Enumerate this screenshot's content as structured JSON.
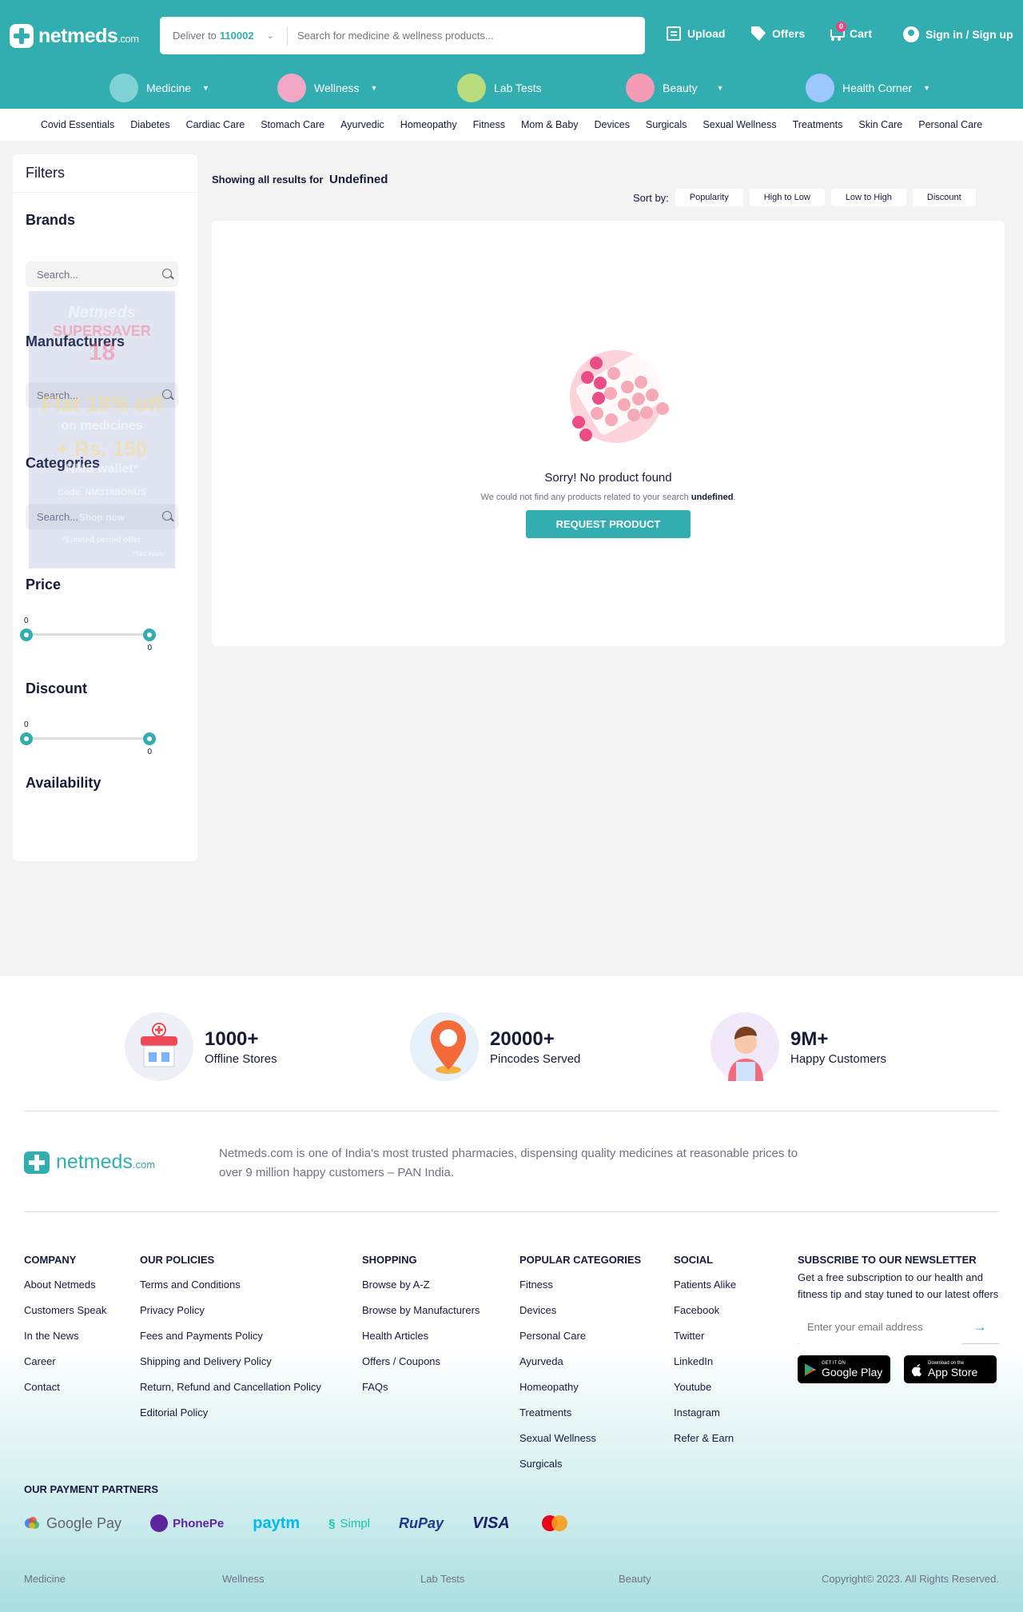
{
  "header": {
    "logo": "netmeds",
    "logo_suffix": ".com",
    "deliver_label": "Deliver to",
    "pincode": "110002",
    "search_placeholder": "Search for medicine & wellness products...",
    "upload": "Upload",
    "offers": "Offers",
    "cart": "Cart",
    "cart_count": "0",
    "signin": "Sign in / Sign up",
    "brand_color": "#32aeb1"
  },
  "categories": [
    {
      "label": "Medicine",
      "icon": "medicine-bottle-icon",
      "color": "#7fd3d4",
      "dropdown": true
    },
    {
      "label": "Wellness",
      "icon": "wellness-icon",
      "color": "#f2a8c4",
      "dropdown": true
    },
    {
      "label": "Lab Tests",
      "icon": "lab-tests-icon",
      "color": "#b9dd7d",
      "dropdown": false
    },
    {
      "label": "Beauty",
      "icon": "beauty-icon",
      "color": "#f59bb6",
      "dropdown": true
    },
    {
      "label": "Health Corner",
      "icon": "health-corner-icon",
      "color": "#9cc8ff",
      "dropdown": true
    }
  ],
  "subnav": [
    "Covid Essentials",
    "Diabetes",
    "Cardiac Care",
    "Stomach Care",
    "Ayurvedic",
    "Homeopathy",
    "Fitness",
    "Mom & Baby",
    "Devices",
    "Surgicals",
    "Sexual Wellness",
    "Treatments",
    "Skin Care",
    "Personal Care"
  ],
  "filters": {
    "title": "Filters",
    "brands": "Brands",
    "manufacturers": "Manufacturers",
    "categories": "Categories",
    "search_placeholder": "Search...",
    "price": "Price",
    "price_min": "0",
    "price_max": "0",
    "discount": "Discount",
    "discount_min": "0",
    "discount_max": "0",
    "availability": "Availability"
  },
  "promo": {
    "line1": "Netmeds",
    "line2": "SUPERSAVER",
    "line3": "18",
    "line4": "Flat 18% off",
    "line5": "on medicines",
    "line6": "+ Rs. 150",
    "line7": "NMS wallet*",
    "code": "Code: NMS18BONUS",
    "cta": "Shop now",
    "note": "*Limited period offer",
    "tc": "*T&C Apply"
  },
  "results": {
    "showing": "Showing all results for",
    "query": "Undefined",
    "sort_label": "Sort by:",
    "sort_options": [
      "Popularity",
      "High to Low",
      "Low to High",
      "Discount"
    ],
    "empty_title": "Sorry! No product found",
    "empty_desc": "We could not find any products related to your search",
    "empty_term": "undefined",
    "request_btn": "REQUEST PRODUCT"
  },
  "stats": [
    {
      "num": "1000+",
      "label": "Offline Stores",
      "icon": "store-icon"
    },
    {
      "num": "20000+",
      "label": "Pincodes Served",
      "icon": "location-pin-icon"
    },
    {
      "num": "9M+",
      "label": "Happy Customers",
      "icon": "customer-icon"
    }
  ],
  "footer": {
    "logo": "netmeds",
    "logo_suffix": ".com",
    "desc": "Netmeds.com is one of India's most trusted pharmacies, dispensing quality medicines at reasonable prices to over 9 million happy customers – PAN India.",
    "columns": [
      {
        "title": "Company",
        "links": [
          "About Netmeds",
          "Customers Speak",
          "In the News",
          "Career",
          "Contact"
        ]
      },
      {
        "title": "Our Policies",
        "links": [
          "Terms and Conditions",
          "Privacy Policy",
          "Fees and Payments Policy",
          "Shipping and Delivery Policy",
          "Return, Refund and Cancellation Policy",
          "Editorial Policy"
        ]
      },
      {
        "title": "Shopping",
        "links": [
          "Browse by A-Z",
          "Browse by Manufacturers",
          "Health Articles",
          "Offers / Coupons",
          "FAQs"
        ]
      },
      {
        "title": "Popular Categories",
        "links": [
          "Fitness",
          "Devices",
          "Personal Care",
          "Ayurveda",
          "Homeopathy",
          "Treatments",
          "Sexual Wellness",
          "Surgicals"
        ]
      },
      {
        "title": "Social",
        "links": [
          "Patients Alike",
          "Facebook",
          "Twitter",
          "LinkedIn",
          "Youtube",
          "Instagram",
          "Refer & Earn"
        ]
      }
    ],
    "newsletter_title": "SUBSCRIBE TO OUR NEWSLETTER",
    "newsletter_desc": "Get a free subscription to our health and fitness tip and stay tuned to our latest offers",
    "email_placeholder": "Enter your email address",
    "google_play_small": "GET IT ON",
    "google_play": "Google Play",
    "app_store_small": "Download on the",
    "app_store": "App Store",
    "payment_title": "OUR PAYMENT PARTNERS",
    "payments": [
      "Google Pay",
      "PhonePe",
      "paytm",
      "Simpl",
      "RuPay",
      "VISA",
      ""
    ],
    "bottom_links": [
      "Medicine",
      "Wellness",
      "Lab Tests",
      "Beauty"
    ],
    "copyright": "Copyright© 2023. All Rights Reserved."
  }
}
